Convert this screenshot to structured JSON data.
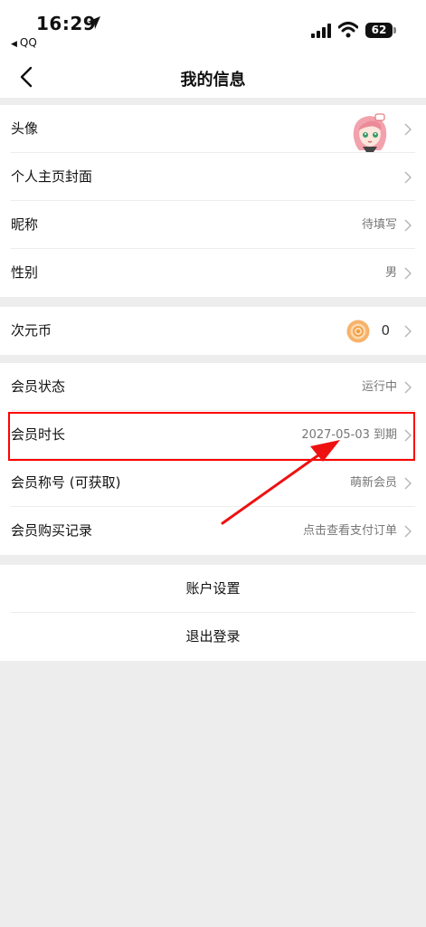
{
  "status_bar": {
    "time": "16:29",
    "back_app": "QQ",
    "battery": "62",
    "icons": [
      "location-arrow-icon",
      "signal-icon",
      "wifi-icon",
      "battery-icon"
    ]
  },
  "header": {
    "title": "我的信息",
    "back_icon": "chevron-left-icon"
  },
  "profile_group": {
    "avatar_label": "头像",
    "cover_label": "个人主页封面",
    "nickname_label": "昵称",
    "nickname_value": "待填写",
    "gender_label": "性别",
    "gender_value": "男"
  },
  "coin_group": {
    "label": "次元币",
    "value": "0"
  },
  "member_group": {
    "status_label": "会员状态",
    "status_value": "运行中",
    "duration_label": "会员时长",
    "duration_value": "2027-05-03 到期",
    "title_label": "会员称号 (可获取)",
    "title_value": "萌新会员",
    "purchase_label": "会员购买记录",
    "purchase_value": "点击查看支付订单"
  },
  "account_group": {
    "settings_label": "账户设置",
    "logout_label": "退出登录"
  },
  "annotation": {
    "highlight_color": "#ff0000"
  }
}
